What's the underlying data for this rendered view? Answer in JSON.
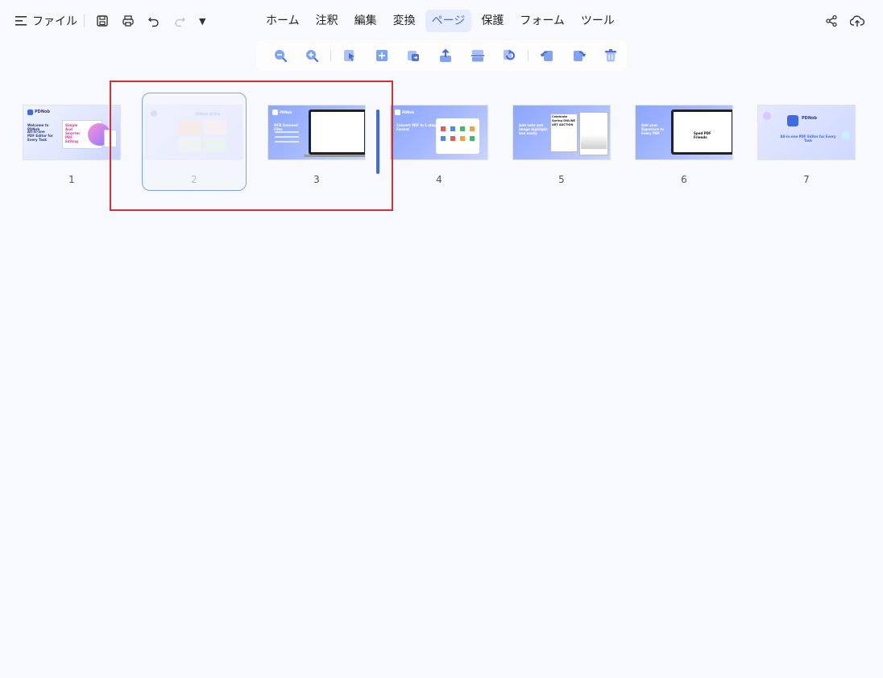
{
  "toolbar": {
    "file_label": "ファイル"
  },
  "tabs": [
    {
      "label": "ホーム"
    },
    {
      "label": "注釈"
    },
    {
      "label": "編集"
    },
    {
      "label": "変換"
    },
    {
      "label": "ページ"
    },
    {
      "label": "保護"
    },
    {
      "label": "フォーム"
    },
    {
      "label": "ツール"
    }
  ],
  "active_tab": "ページ",
  "accent_color": "#4a6fe3",
  "highlight_color": "#d62f2f",
  "page_tools": [
    "zoom-out-icon",
    "zoom-in-icon",
    "select-icon",
    "insert-page-icon",
    "replace-page-icon",
    "extract-icon",
    "split-icon",
    "rotate-icon",
    "rotate-left-icon",
    "rotate-right-icon",
    "delete-icon"
  ],
  "pages": [
    {
      "number": "1",
      "title": "PDNob",
      "subtitle": "Welcome to PDNob",
      "caption": "All-in-one PDF Editor for Every Task",
      "note": "Simple And Smarter PDF Editing"
    },
    {
      "number": "2",
      "title": "PDNob AI Pro"
    },
    {
      "number": "3",
      "title": "PDNob",
      "caption": "OCR Scanned Files"
    },
    {
      "number": "4",
      "title": "PDNob",
      "caption": "Convert PDF in 1 step Format"
    },
    {
      "number": "5",
      "caption": "Add note and image highlight box easily",
      "note": "Celebrate Spring ONLINE ART AUCTION"
    },
    {
      "number": "6",
      "caption": "Add your Signature to Every PDF",
      "note": "Sped PDF Friends"
    },
    {
      "number": "7",
      "title": "PDNob",
      "caption": "All-in-one PDF Editor for Every Task"
    }
  ]
}
